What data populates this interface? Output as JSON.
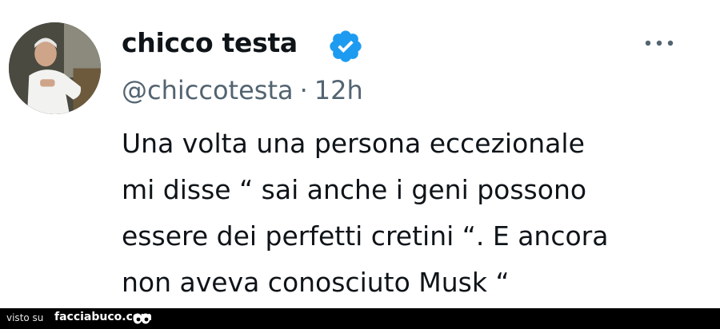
{
  "tweet": {
    "author_name": "chicco testa",
    "handle": "@chiccotesta",
    "separator": "·",
    "time": "12h",
    "body_lines": [
      "Una volta una persona eccezionale",
      "mi disse “ sai anche i geni possono",
      "essere dei perfetti cretini “. E ancora",
      "non aveva conosciuto Musk “"
    ],
    "icons": {
      "avatar": "avatar-photo",
      "verified": "verified-badge-icon",
      "more": "more-options-icon"
    },
    "colors": {
      "verified_blue": "#1d9bf0",
      "secondary_text": "#536471",
      "primary_text": "#0f1419"
    }
  },
  "footer": {
    "prefix": "visto su",
    "site": "facciabuco.com"
  }
}
